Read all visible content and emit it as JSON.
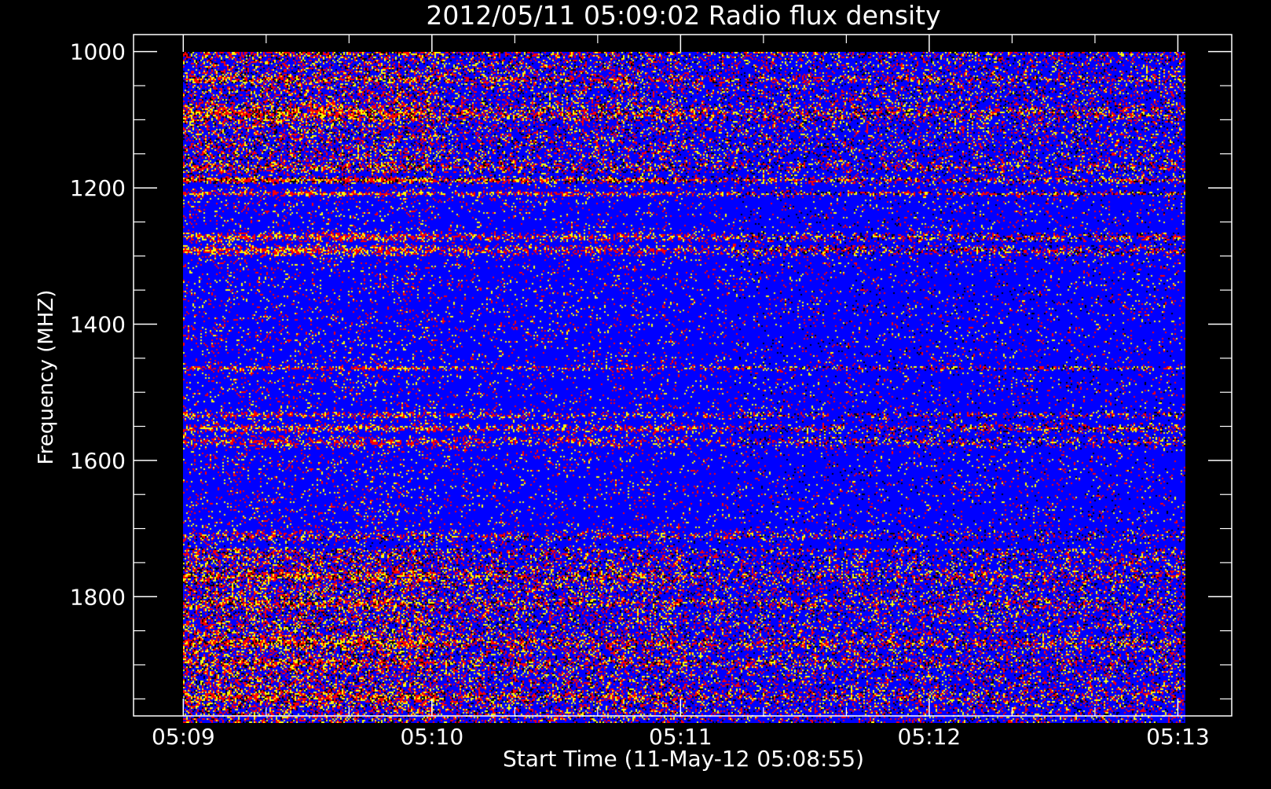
{
  "chart_data": {
    "type": "heatmap",
    "title": "2012/05/11 05:09:02 Radio flux density",
    "xlabel": "Start Time (11-May-12 05:08:55)",
    "ylabel": "Frequency (MHZ)",
    "x_ticks": [
      {
        "value": 0,
        "label": "05:09"
      },
      {
        "value": 60,
        "label": "05:10"
      },
      {
        "value": 120,
        "label": "05:11"
      },
      {
        "value": 180,
        "label": "05:12"
      },
      {
        "value": 240,
        "label": "05:13"
      }
    ],
    "x_minor_step": 20,
    "xlim": [
      -12,
      253
    ],
    "x_data_range": [
      0,
      240
    ],
    "y_ticks": [
      {
        "value": 1000,
        "label": "1000"
      },
      {
        "value": 1200,
        "label": "1200"
      },
      {
        "value": 1400,
        "label": "1400"
      },
      {
        "value": 1600,
        "label": "1600"
      },
      {
        "value": 1800,
        "label": "1800"
      }
    ],
    "y_minor_step": 50,
    "ylim": [
      1975,
      975
    ],
    "y_data_range": [
      1000,
      2000
    ],
    "y_inverted": true,
    "colormap": [
      "#000000",
      "#0000ff",
      "#ff0000",
      "#ffff00"
    ],
    "background_color": "#0000ff",
    "axis_color": "#ffffff",
    "bright_bands_mhz": [
      {
        "f": 1000,
        "w": 20,
        "level": 0.6
      },
      {
        "f": 1040,
        "w": 12,
        "level": 0.7
      },
      {
        "f": 1090,
        "w": 25,
        "level": 0.75
      },
      {
        "f": 1170,
        "w": 15,
        "level": 0.6
      },
      {
        "f": 1190,
        "w": 6,
        "level": 0.95
      },
      {
        "f": 1210,
        "w": 4,
        "level": 1.0
      },
      {
        "f": 1275,
        "w": 8,
        "level": 0.85
      },
      {
        "f": 1295,
        "w": 10,
        "level": 0.8
      },
      {
        "f": 1470,
        "w": 4,
        "level": 0.8
      },
      {
        "f": 1540,
        "w": 6,
        "level": 0.7
      },
      {
        "f": 1560,
        "w": 8,
        "level": 0.75
      },
      {
        "f": 1580,
        "w": 10,
        "level": 0.65
      },
      {
        "f": 1720,
        "w": 10,
        "level": 0.55
      },
      {
        "f": 1780,
        "w": 20,
        "level": 0.7
      },
      {
        "f": 1820,
        "w": 20,
        "level": 0.65
      },
      {
        "f": 1880,
        "w": 20,
        "level": 0.75
      },
      {
        "f": 1910,
        "w": 15,
        "level": 0.7
      },
      {
        "f": 1960,
        "w": 25,
        "level": 0.7
      }
    ]
  }
}
